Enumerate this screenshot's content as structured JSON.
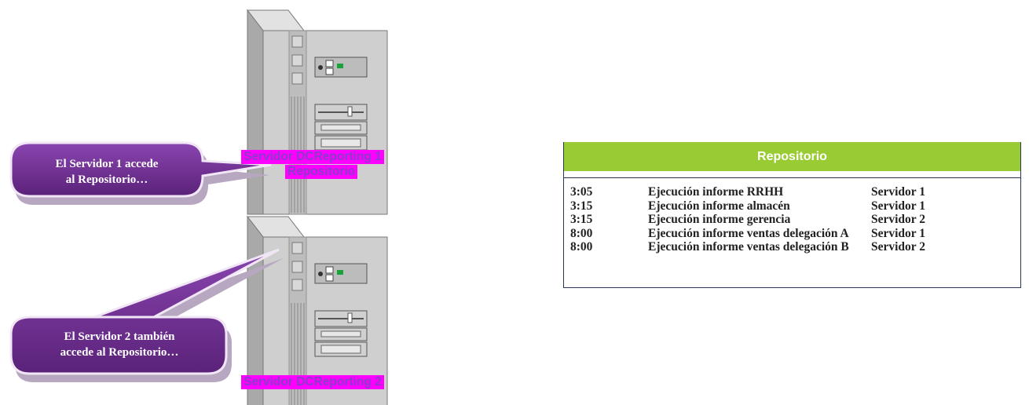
{
  "servers": [
    {
      "label_lines": [
        "Servidor DCReporting 1",
        "Repositorio"
      ],
      "icon": "server-tower-icon"
    },
    {
      "label_lines": [
        "Servidor DCReporting 2"
      ],
      "icon": "server-tower-icon"
    }
  ],
  "callouts": [
    {
      "lines": [
        "El Servidor 1 accede",
        "al Repositorio…"
      ]
    },
    {
      "lines": [
        "El Servidor 2 también",
        "accede al Repositorio…"
      ]
    }
  ],
  "repository": {
    "title": "Repositorio",
    "rows": [
      {
        "time": "3:05",
        "job": "Ejecución informe RRHH",
        "server": "Servidor 1"
      },
      {
        "time": "3:15",
        "job": "Ejecución informe almacén",
        "server": "Servidor 1"
      },
      {
        "time": "3:15",
        "job": "Ejecución informe gerencia",
        "server": "Servidor 2"
      },
      {
        "time": "8:00",
        "job": "Ejecución informe ventas delegación A",
        "server": "Servidor 1"
      },
      {
        "time": "8:00",
        "job": "Ejecución informe ventas delegación B",
        "server": "Servidor 2"
      }
    ]
  },
  "colors": {
    "callout": "#6b2d8e",
    "header": "#99cc33",
    "highlight": "#ff00ff",
    "server": "#c8c8c8"
  }
}
